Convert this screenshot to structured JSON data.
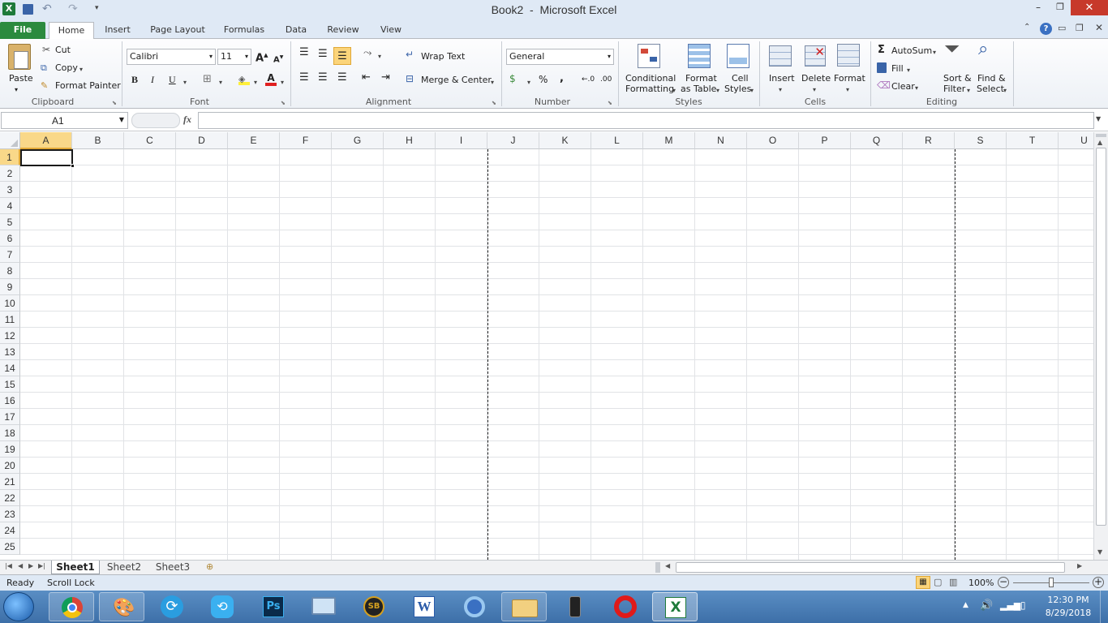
{
  "window": {
    "title": "Book2  -  Microsoft Excel"
  },
  "tabs": [
    "File",
    "Home",
    "Insert",
    "Page Layout",
    "Formulas",
    "Data",
    "Review",
    "View"
  ],
  "clipboard": {
    "paste": "Paste",
    "cut": "Cut",
    "copy": "Copy",
    "format_painter": "Format Painter",
    "label": "Clipboard"
  },
  "font": {
    "name": "Calibri",
    "size": "11",
    "bold": "B",
    "italic": "I",
    "underline": "U",
    "label": "Font"
  },
  "alignment": {
    "wrap_text": "Wrap Text",
    "merge_center": "Merge & Center",
    "label": "Alignment"
  },
  "number": {
    "format": "General",
    "percent": "%",
    "comma": ",",
    "label": "Number"
  },
  "styles": {
    "conditional_1": "Conditional",
    "conditional_2": "Formatting",
    "table_1": "Format",
    "table_2": "as Table",
    "cell_1": "Cell",
    "cell_2": "Styles",
    "label": "Styles"
  },
  "cells": {
    "insert": "Insert",
    "delete": "Delete",
    "format": "Format",
    "label": "Cells"
  },
  "editing": {
    "autosum": "AutoSum",
    "fill": "Fill",
    "clear": "Clear",
    "sort_1": "Sort &",
    "sort_2": "Filter",
    "find_1": "Find &",
    "find_2": "Select",
    "label": "Editing"
  },
  "formula_bar": {
    "name_box": "A1",
    "fx": "fx",
    "value": ""
  },
  "columns": [
    "A",
    "B",
    "C",
    "D",
    "E",
    "F",
    "G",
    "H",
    "I",
    "J",
    "K",
    "L",
    "M",
    "N",
    "O",
    "P",
    "Q",
    "R",
    "S",
    "T",
    "U"
  ],
  "rows": [
    "1",
    "2",
    "3",
    "4",
    "5",
    "6",
    "7",
    "8",
    "9",
    "10",
    "11",
    "12",
    "13",
    "14",
    "15",
    "16",
    "17",
    "18",
    "19",
    "20",
    "21",
    "22",
    "23",
    "24",
    "25"
  ],
  "sheets": [
    "Sheet1",
    "Sheet2",
    "Sheet3"
  ],
  "status": {
    "ready": "Ready",
    "scroll_lock": "Scroll Lock",
    "zoom": "100%"
  },
  "taskbar": {
    "time": "12:30 PM",
    "date": "8/29/2018"
  },
  "colors": {
    "file_tab": "#2b8a3e",
    "accent": "#f5c24c",
    "taskbar": "#4a7fb8"
  }
}
